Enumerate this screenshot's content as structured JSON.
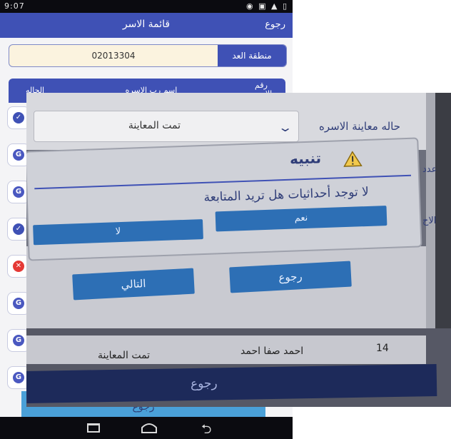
{
  "status_bar": {
    "time": "9:07",
    "icons": "signal wifi battery"
  },
  "app_bar": {
    "title": "قائمة الاسر",
    "back_label": "رجوع"
  },
  "area": {
    "label": "منطقة العد",
    "value": "02013304"
  },
  "table": {
    "headers": {
      "number_line1": "رقم",
      "number_line2": "الاسره",
      "name": "اسم رب الاسره",
      "status": "الحاله"
    },
    "rows": [
      {
        "status": "ok",
        "icon": "check-circle-icon",
        "glyph": "✓"
      },
      {
        "status": "pend",
        "icon": "status-g-icon",
        "glyph": "G"
      },
      {
        "status": "pend",
        "icon": "status-g-icon",
        "glyph": "G"
      },
      {
        "status": "ok",
        "icon": "check-circle-icon",
        "glyph": "✓"
      },
      {
        "status": "err",
        "icon": "error-circle-icon",
        "glyph": "✕"
      },
      {
        "status": "pend",
        "icon": "status-g-icon",
        "glyph": "G"
      },
      {
        "status": "pend",
        "icon": "status-g-icon",
        "glyph": "G"
      },
      {
        "status": "pend",
        "icon": "status-g-icon",
        "glyph": "G"
      }
    ]
  },
  "bottom_button": {
    "label": "رجوع"
  },
  "photo": {
    "inspection_label": "حاله معاينة الاسره",
    "dropdown_value": "تمت المعاينة",
    "cut_label_1": "عدد",
    "cut_label_2": "الاح",
    "dialog": {
      "title": "تنبيه",
      "message": "لا توجد أحداثيات هل تريد المتابعة",
      "yes_label": "نعم",
      "no_label": "لا"
    },
    "back_button": "رجوع",
    "next_button": "التالي",
    "row": {
      "number": "14",
      "name": "احمد صفا احمد",
      "status": "تمت المعاينة"
    },
    "bottom_bar_label": "رجوع"
  },
  "colors": {
    "primary": "#3f51b5",
    "error": "#e53935",
    "photo_button": "#2d6fb5"
  }
}
